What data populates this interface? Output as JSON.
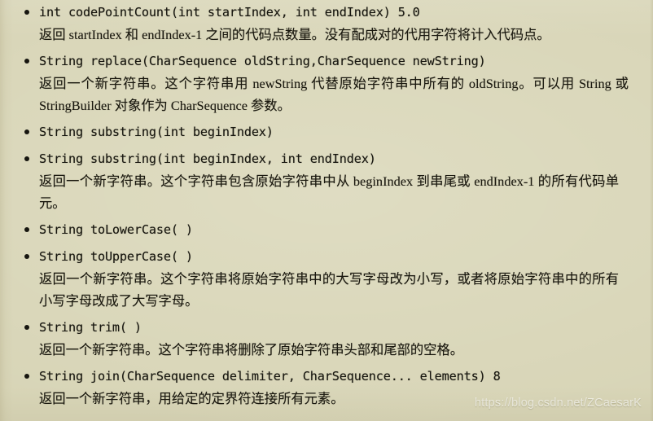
{
  "page": {
    "background_color": "#d8d5b7",
    "text_color": "#17160f",
    "watermark": "https://blog.csdn.net/ZCaesarK"
  },
  "api_entries": [
    {
      "signature": "int codePointCount(int startIndex, int endIndex) 5.0",
      "description": "返回 startIndex 和 endIndex-1 之间的代码点数量。没有配成对的代用字符将计入代码点。"
    },
    {
      "signature": "String replace(CharSequence oldString,CharSequence newString)",
      "description": "返回一个新字符串。这个字符串用 newString 代替原始字符串中所有的 oldString。可以用 String 或 StringBuilder 对象作为 CharSequence 参数。"
    },
    {
      "signature": "String substring(int beginIndex)",
      "description": ""
    },
    {
      "signature": "String substring(int beginIndex, int endIndex)",
      "description": "返回一个新字符串。这个字符串包含原始字符串中从 beginIndex 到串尾或 endIndex-1 的所有代码单元。"
    },
    {
      "signature": "String toLowerCase( )",
      "description": ""
    },
    {
      "signature": "String toUpperCase( )",
      "description": "返回一个新字符串。这个字符串将原始字符串中的大写字母改为小写，或者将原始字符串中的所有小写字母改成了大写字母。"
    },
    {
      "signature": "String trim( )",
      "description": "返回一个新字符串。这个字符串将删除了原始字符串头部和尾部的空格。"
    },
    {
      "signature": "String join(CharSequence delimiter, CharSequence... elements) 8",
      "description": "返回一个新字符串，用给定的定界符连接所有元素。"
    }
  ]
}
